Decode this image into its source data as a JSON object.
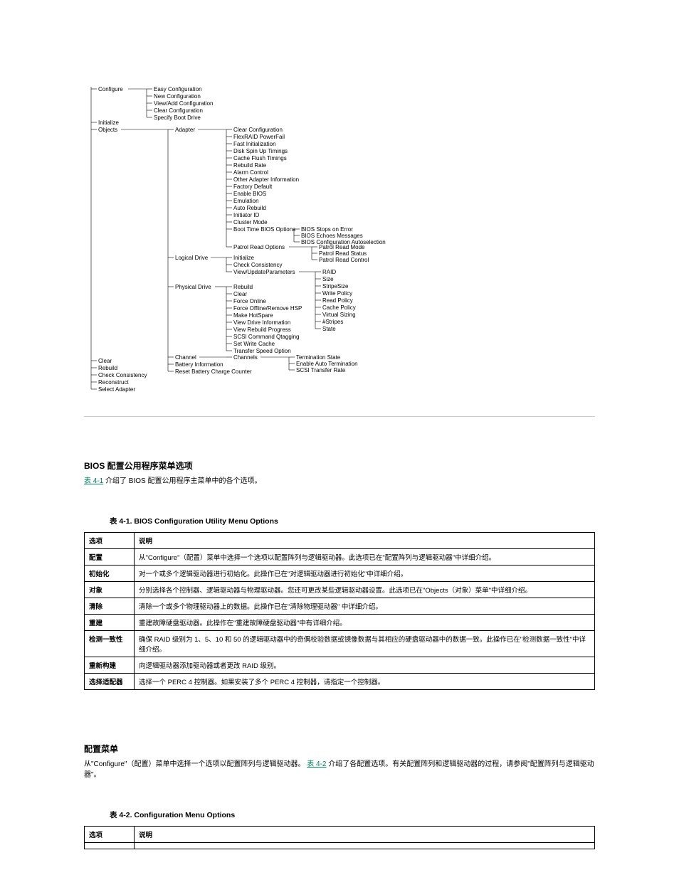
{
  "diagram_tree": {
    "root": [
      {
        "label": "Configure",
        "children": [
          {
            "label": "Easy Configuration"
          },
          {
            "label": "New Configuration"
          },
          {
            "label": "View/Add Configuration"
          },
          {
            "label": "Clear Configuration"
          },
          {
            "label": "Specify Boot Drive"
          }
        ]
      },
      {
        "label": "Initialize"
      },
      {
        "label": "Objects",
        "children": [
          {
            "label": "Adapter",
            "children": [
              {
                "label": "Clear Configuration"
              },
              {
                "label": "FlexRAID PowerFail"
              },
              {
                "label": "Fast Initialization"
              },
              {
                "label": "Disk Spin Up Timings"
              },
              {
                "label": "Cache Flush Timings"
              },
              {
                "label": "Rebuild Rate"
              },
              {
                "label": "Alarm Control"
              },
              {
                "label": "Other Adapter Information"
              },
              {
                "label": "Factory Default"
              },
              {
                "label": "Enable BIOS"
              },
              {
                "label": "Emulation"
              },
              {
                "label": "Auto Rebuild"
              },
              {
                "label": "Initiator ID"
              },
              {
                "label": "Cluster Mode"
              },
              {
                "label": "Boot Time BIOS Options",
                "children": [
                  {
                    "label": "BIOS Stops on Error"
                  },
                  {
                    "label": "BIOS Echoes Messages"
                  },
                  {
                    "label": "BIOS Configuration Autoselection"
                  }
                ]
              },
              {
                "label": "Patrol Read Options",
                "children": [
                  {
                    "label": "Patrol Read Mode"
                  },
                  {
                    "label": "Patrol Read Status"
                  },
                  {
                    "label": "Patrol Read Control"
                  }
                ]
              }
            ]
          },
          {
            "label": "Logical Drive",
            "children": [
              {
                "label": "Initialize"
              },
              {
                "label": "Check Consistency"
              },
              {
                "label": "View/UpdateParameters",
                "children": [
                  {
                    "label": "RAID"
                  },
                  {
                    "label": "Size"
                  },
                  {
                    "label": "StripeSize"
                  },
                  {
                    "label": "Write Policy"
                  },
                  {
                    "label": "Read Policy"
                  },
                  {
                    "label": "Cache Policy"
                  },
                  {
                    "label": "Virtual Sizing"
                  },
                  {
                    "label": "#Stripes"
                  },
                  {
                    "label": "State"
                  }
                ]
              }
            ]
          },
          {
            "label": "Physical Drive",
            "children": [
              {
                "label": "Rebuild"
              },
              {
                "label": "Clear"
              },
              {
                "label": "Force Online"
              },
              {
                "label": "Force Offline/Remove HSP"
              },
              {
                "label": "Make HotSpare"
              },
              {
                "label": "View Drive Information"
              },
              {
                "label": "View Rebuild Progress"
              },
              {
                "label": "SCSI Command Qtagging"
              },
              {
                "label": "Set Write Cache"
              },
              {
                "label": "Transfer Speed Option"
              }
            ]
          },
          {
            "label": "Channel",
            "children": [
              {
                "label": "Channels",
                "children": [
                  {
                    "label": "Termination State"
                  },
                  {
                    "label": "Enable Auto Termination"
                  },
                  {
                    "label": "SCSI Transfer Rate"
                  }
                ]
              }
            ]
          },
          {
            "label": "Battery Information"
          },
          {
            "label": "Reset Battery Charge Counter"
          }
        ]
      },
      {
        "label": "Clear"
      },
      {
        "label": "Rebuild"
      },
      {
        "label": "Check Consistency"
      },
      {
        "label": "Reconstruct"
      },
      {
        "label": "Select Adapter"
      }
    ]
  },
  "section1_head": "BIOS 配置公用程序菜单选项",
  "section1_para_before": "",
  "section1_link": "表 4-1",
  "section1_para_after": " 介绍了 BIOS 配置公用程序主菜单中的各个选项。",
  "table1_caption": "表 4-1. BIOS Configuration Utility Menu Options",
  "table1": {
    "headers": [
      "选项",
      "说明"
    ],
    "rows": [
      [
        "配置",
        "从\"Configure\"（配置）菜单中选择一个选项以配置阵列与逻辑驱动器。此选项已在\"配置阵列与逻辑驱动器\"中详细介绍。"
      ],
      [
        "初始化",
        "对一个或多个逻辑驱动器进行初始化。此操作已在\"对逻辑驱动器进行初始化\"中详细介绍。"
      ],
      [
        "对象",
        "分别选择各个控制器、逻辑驱动器与物理驱动器。您还可更改某些逻辑驱动器设置。此选项已在\"Objects（对象）菜单\"中详细介绍。"
      ],
      [
        "清除",
        "清除一个或多个物理驱动器上的数据。此操作已在\"清除物理驱动器\" 中详细介绍。"
      ],
      [
        "重建",
        "重建故障硬盘驱动器。此操作在\"重建故障硬盘驱动器\"中有详细介绍。"
      ],
      [
        "检测一致性",
        "确保 RAID 级别为 1、5、10 和 50 的逻辑驱动器中的奇偶校验数据或镜像数据与其相应的硬盘驱动器中的数据一致。此操作已在\"检测数据一致性\"中详细介绍。"
      ],
      [
        "重新构建",
        "向逻辑驱动器添加驱动器或者更改 RAID 级别。"
      ],
      [
        "选择适配器",
        "选择一个 PERC 4 控制器。如果安装了多个 PERC 4 控制器，请指定一个控制器。"
      ]
    ]
  },
  "section2_head": "配置菜单",
  "section2_para_a": "从\"Configure\"（配置）菜单中选择一个选项以配置阵列与逻辑驱动器。",
  "section2_link": "表 4-2",
  "section2_para_b": " 介绍了各配置选项。有关配置阵列和逻辑驱动器的过程，请参阅\"配置阵列与逻辑驱动器\"。",
  "table2_caption": "表 4-2. Configuration Menu Options",
  "table2": {
    "headers": [
      "选项",
      "说明"
    ]
  }
}
